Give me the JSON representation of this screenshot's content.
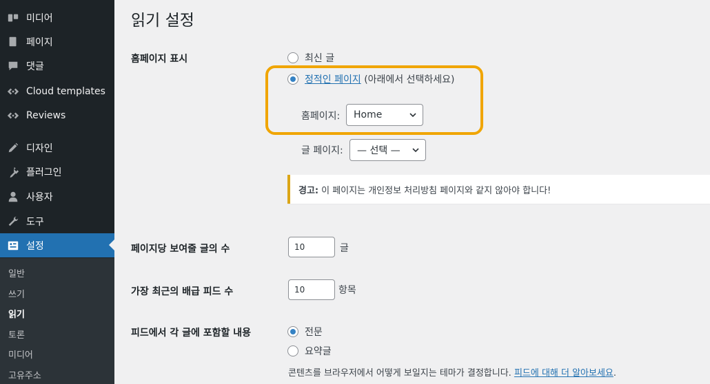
{
  "sidebar": {
    "items": [
      {
        "label": "미디어",
        "icon": "media-icon"
      },
      {
        "label": "페이지",
        "icon": "pages-icon"
      },
      {
        "label": "댓글",
        "icon": "comments-icon"
      },
      {
        "label": "Cloud templates",
        "icon": "cloud-templates-icon"
      },
      {
        "label": "Reviews",
        "icon": "reviews-icon"
      },
      {
        "label": "디자인",
        "icon": "appearance-icon"
      },
      {
        "label": "플러그인",
        "icon": "plugins-icon"
      },
      {
        "label": "사용자",
        "icon": "users-icon"
      },
      {
        "label": "도구",
        "icon": "tools-icon"
      },
      {
        "label": "설정",
        "icon": "settings-icon",
        "current": true
      }
    ],
    "submenu": [
      "일반",
      "쓰기",
      "읽기",
      "토론",
      "미디어",
      "고유주소"
    ],
    "submenu_current": "읽기"
  },
  "page": {
    "title": "읽기 설정"
  },
  "homepage_display": {
    "label": "홈페이지 표시",
    "option_latest": "최신 글",
    "option_static_link": "정적인 페이지",
    "option_static_suffix": "(아래에서 선택하세요)",
    "selected": "static",
    "homepage_label": "홈페이지:",
    "homepage_value": "Home",
    "posts_page_label": "글 페이지:",
    "posts_page_value": "— 선택 —"
  },
  "notice": {
    "strong": "경고:",
    "text": "이 페이지는 개인정보 처리방침 페이지와 같지 않아야 합니다!"
  },
  "posts_per_page": {
    "label": "페이지당 보여줄 글의 수",
    "value": "10",
    "unit": "글"
  },
  "feed_items": {
    "label": "가장 최근의 배급 피드 수",
    "value": "10",
    "unit": "항목"
  },
  "feed_content": {
    "label": "피드에서 각 글에 포함할 내용",
    "option_full": "전문",
    "option_excerpt": "요약글",
    "selected": "full",
    "description": "콘텐츠를 브라우저에서 어떻게 보일지는 테마가 결정합니다.",
    "learn_more": "피드에 대해 더 알아보세요",
    "period": "."
  },
  "colors": {
    "sidebar_bg": "#1d2327",
    "accent": "#2271b1",
    "highlight": "#f0a500",
    "warning": "#dba617"
  }
}
